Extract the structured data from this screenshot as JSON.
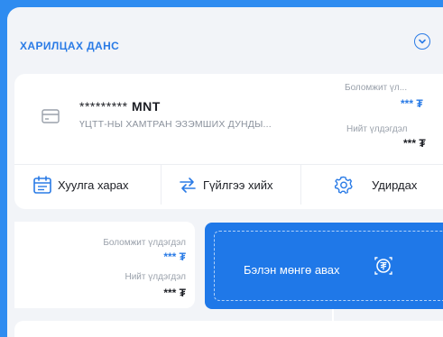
{
  "account": {
    "header": "ХАРИЛЦАХ ДАНС",
    "masked_number": "*********",
    "currency": "MNT",
    "name": "ҮЦТТ-НЫ ХАМТРАН ЭЗЭМШИХ ДУНДЫ...",
    "available_label": "Боломжит үл...",
    "available_value": "*** ₮",
    "total_label": "Нийт үлдэгдэл",
    "total_value": "*** ₮"
  },
  "actions": {
    "statement": "Хуулга харах",
    "transfer": "Гүйлгээ хийх",
    "manage": "Удирдах"
  },
  "mini_card": {
    "available_label": "Боломжит үлдэгдэл",
    "available_value": "*** ₮",
    "total_label": "Нийт үлдэгдэл",
    "total_value": "*** ₮"
  },
  "cash_button": {
    "label": "Бэлэн мөнгө авах"
  },
  "colors": {
    "accent": "#2a7be6",
    "button": "#1f78e8",
    "background": "#2f8cf0"
  },
  "icons": {
    "expand": "chevron-down-circle-icon",
    "card": "card-icon",
    "statement": "calendar-icon",
    "transfer": "transfer-arrows-icon",
    "manage": "gear-icon",
    "cash": "tugrik-coin-icon"
  }
}
